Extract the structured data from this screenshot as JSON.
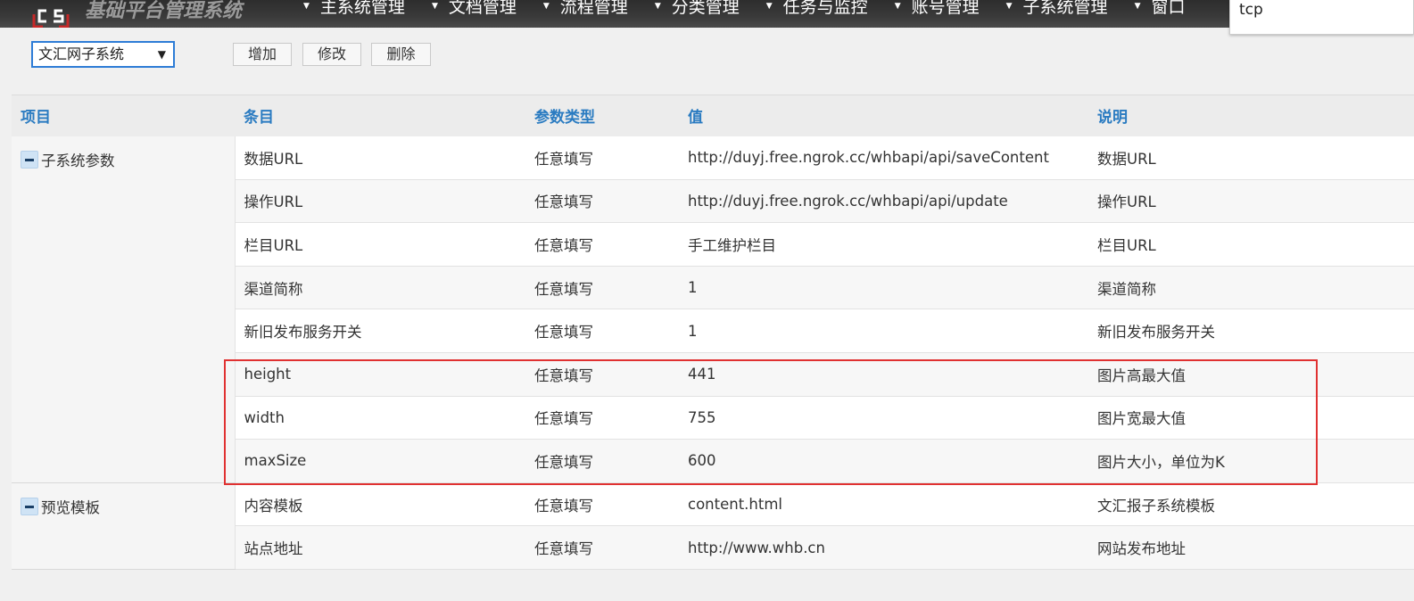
{
  "header": {
    "title": "基础平台管理系统",
    "nav": [
      {
        "label": "主系统管理"
      },
      {
        "label": "文档管理"
      },
      {
        "label": "流程管理"
      },
      {
        "label": "分类管理"
      },
      {
        "label": "任务与监控"
      },
      {
        "label": "账号管理"
      },
      {
        "label": "子系统管理"
      },
      {
        "label": "窗口"
      }
    ],
    "search_value": "tcp"
  },
  "toolbar": {
    "system_select": "文汇网子系统",
    "add_label": "增加",
    "edit_label": "修改",
    "delete_label": "删除"
  },
  "table": {
    "columns": [
      "项目",
      "条目",
      "参数类型",
      "值",
      "说明"
    ],
    "groups": [
      {
        "name": "子系统参数",
        "rows": [
          {
            "item": "数据URL",
            "type": "任意填写",
            "value": "http://duyj.free.ngrok.cc/whbapi/api/saveContent",
            "desc": "数据URL"
          },
          {
            "item": "操作URL",
            "type": "任意填写",
            "value": "http://duyj.free.ngrok.cc/whbapi/api/update",
            "desc": "操作URL"
          },
          {
            "item": "栏目URL",
            "type": "任意填写",
            "value": "手工维护栏目",
            "desc": "栏目URL"
          },
          {
            "item": "渠道简称",
            "type": "任意填写",
            "value": "1",
            "desc": "渠道简称"
          },
          {
            "item": "新旧发布服务开关",
            "type": "任意填写",
            "value": "1",
            "desc": "新旧发布服务开关"
          },
          {
            "item": "height",
            "type": "任意填写",
            "value": "441",
            "desc": "图片高最大值"
          },
          {
            "item": "width",
            "type": "任意填写",
            "value": "755",
            "desc": "图片宽最大值"
          },
          {
            "item": "maxSize",
            "type": "任意填写",
            "value": "600",
            "desc": "图片大小，单位为K"
          }
        ]
      },
      {
        "name": "预览模板",
        "rows": [
          {
            "item": "内容模板",
            "type": "任意填写",
            "value": "content.html",
            "desc": "文汇报子系统模板"
          },
          {
            "item": "站点地址",
            "type": "任意填写",
            "value": "http://www.whb.cn",
            "desc": "网站发布地址"
          }
        ]
      }
    ]
  },
  "colors": {
    "accent": "#2a7bc1",
    "highlight": "#e03131",
    "topbar": "#333333"
  }
}
